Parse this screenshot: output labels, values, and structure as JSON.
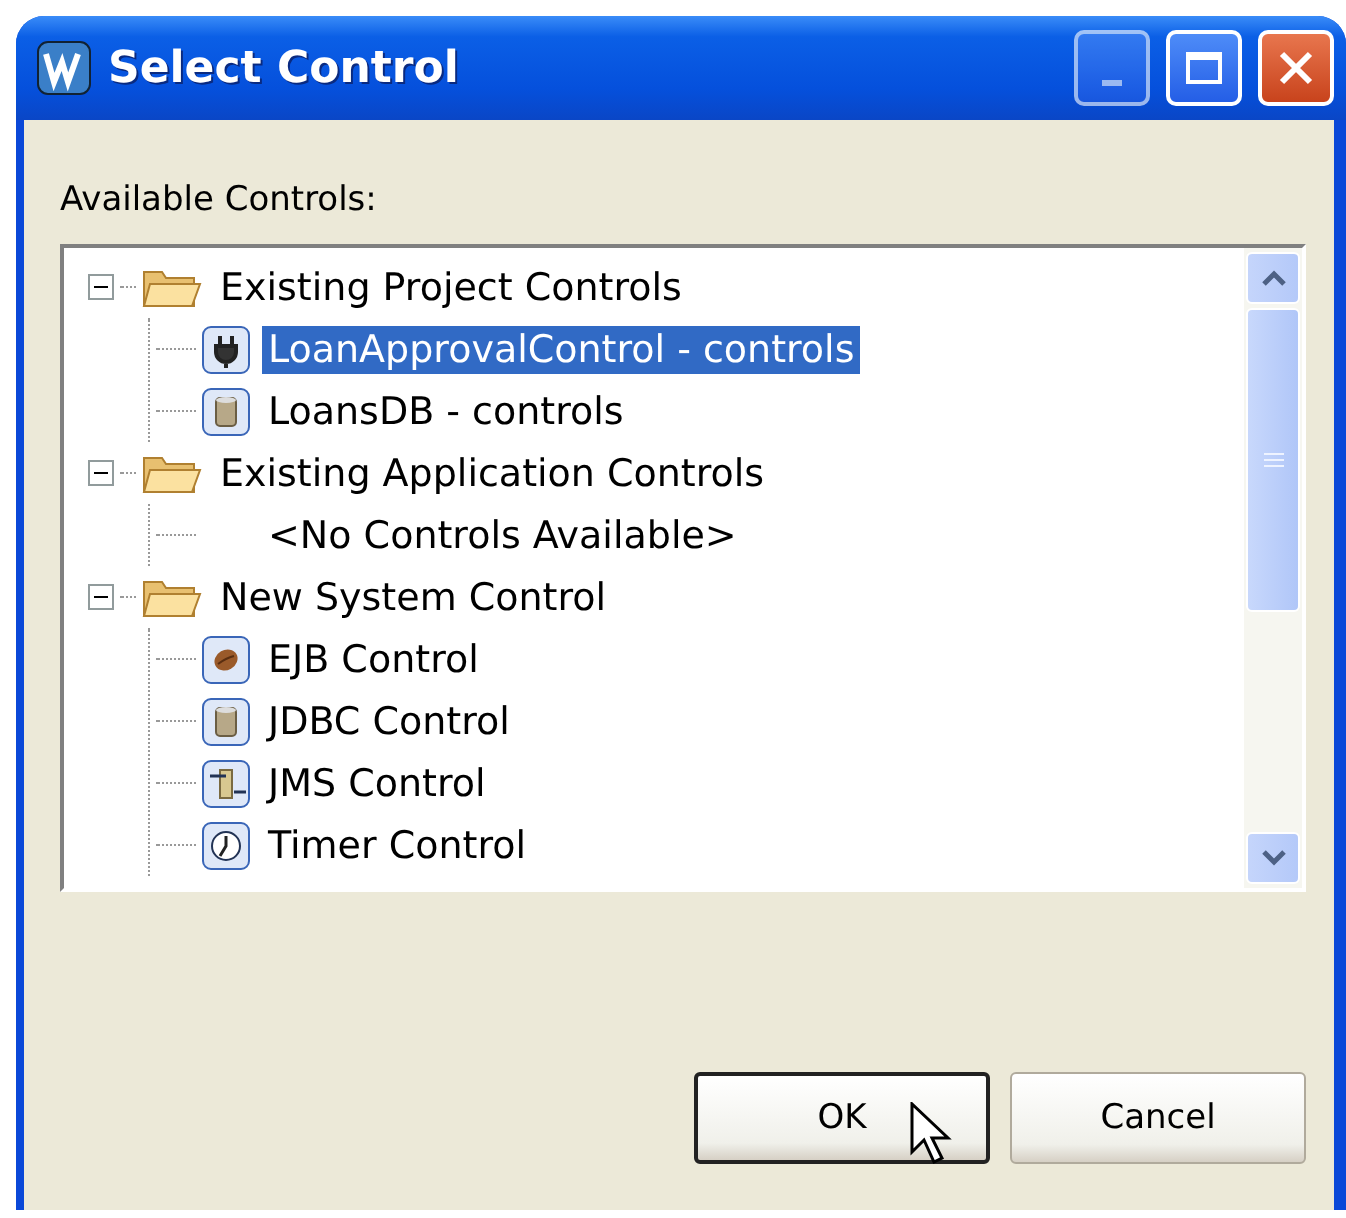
{
  "window": {
    "title": "Select Control"
  },
  "label": "Available Controls:",
  "tree": [
    {
      "label": "Existing Project Controls",
      "expanded": true,
      "children": [
        {
          "label": "LoanApprovalControl - controls",
          "kind": "plug",
          "selected": true
        },
        {
          "label": "LoansDB - controls",
          "kind": "database",
          "selected": false
        }
      ]
    },
    {
      "label": "Existing Application Controls",
      "expanded": true,
      "children": [
        {
          "label": "<No Controls Available>",
          "kind": "empty",
          "selected": false
        }
      ]
    },
    {
      "label": "New System Control",
      "expanded": true,
      "children": [
        {
          "label": "EJB Control",
          "kind": "bean",
          "selected": false
        },
        {
          "label": "JDBC Control",
          "kind": "database",
          "selected": false
        },
        {
          "label": "JMS Control",
          "kind": "queue",
          "selected": false
        },
        {
          "label": "Timer Control",
          "kind": "timer",
          "selected": false
        }
      ]
    }
  ],
  "buttons": [
    {
      "label": "OK",
      "default": true
    },
    {
      "label": "Cancel",
      "default": false
    }
  ]
}
